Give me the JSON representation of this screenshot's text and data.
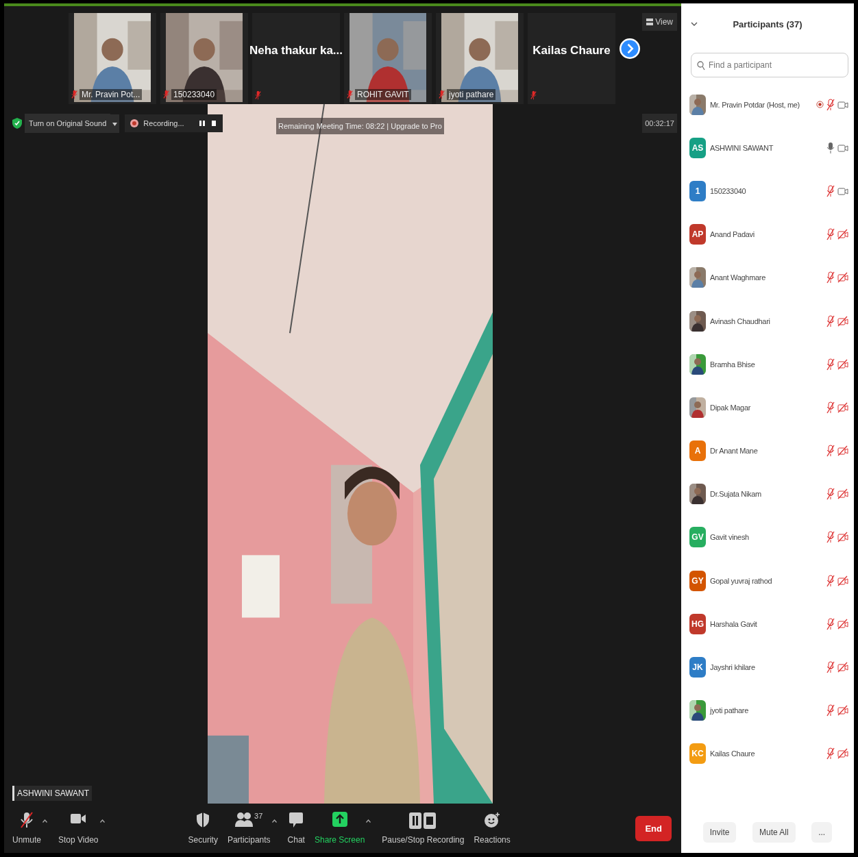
{
  "thumbnails": [
    {
      "name": "Mr. Pravin Pot...",
      "kind": "picture",
      "muted": true
    },
    {
      "name": "150233040",
      "kind": "picture",
      "muted": true
    },
    {
      "name": "Neha thakur ka...",
      "kind": "name",
      "muted": true
    },
    {
      "name": "ROHIT GAVIT",
      "kind": "picture",
      "muted": true
    },
    {
      "name": "jyoti pathare",
      "kind": "picture",
      "muted": true
    },
    {
      "name": "Kailas Chaure",
      "kind": "name",
      "muted": true
    }
  ],
  "view_button": "View",
  "original_sound_button": "Turn on Original Sound",
  "recording": {
    "label": "Recording..."
  },
  "meeting_banner": "Remaining Meeting Time: 08:22 | Upgrade to Pro",
  "timer": "00:32:17",
  "active_speaker": "ASHWINI SAWANT",
  "toolbar": [
    {
      "label": "Unmute",
      "caret": true
    },
    {
      "label": "Stop Video",
      "caret": true
    },
    {
      "label": "Security",
      "caret": false
    },
    {
      "label": "Participants",
      "caret": true,
      "count": "37"
    },
    {
      "label": "Chat",
      "caret": false
    },
    {
      "label": "Share Screen",
      "caret": true
    },
    {
      "label": "Pause/Stop Recording",
      "caret": false
    },
    {
      "label": "Reactions",
      "caret": false
    }
  ],
  "end_button": "End",
  "participants_panel": {
    "title": "Participants (37)",
    "search": {
      "placeholder": "Find a participant"
    },
    "participants": [
      {
        "name": "Mr. Pravin Potdar (Host, me)",
        "kind": "picture",
        "recording": true,
        "mic_muted": true,
        "video_on": true
      },
      {
        "name": "ASHWINI SAWANT",
        "kind": "initials",
        "initials": "AS",
        "color": "#16a085",
        "recording": false,
        "mic_muted": false,
        "video_on": true
      },
      {
        "name": "150233040",
        "kind": "initials",
        "initials": "1",
        "color": "#2e7dc6",
        "recording": false,
        "mic_muted": true,
        "video_on": true
      },
      {
        "name": "Anand Padavi",
        "kind": "initials",
        "initials": "AP",
        "color": "#c0392b",
        "recording": false,
        "mic_muted": true,
        "video_on": false
      },
      {
        "name": "Anant Waghmare",
        "kind": "picture",
        "recording": false,
        "mic_muted": true,
        "video_on": false
      },
      {
        "name": "Avinash Chaudhari",
        "kind": "picture",
        "recording": false,
        "mic_muted": true,
        "video_on": false
      },
      {
        "name": "Bramha Bhise",
        "kind": "picture",
        "recording": false,
        "mic_muted": true,
        "video_on": false
      },
      {
        "name": "Dipak Magar",
        "kind": "picture",
        "recording": false,
        "mic_muted": true,
        "video_on": false
      },
      {
        "name": "Dr Anant Mane",
        "kind": "initials",
        "initials": "A",
        "color": "#e8710a",
        "recording": false,
        "mic_muted": true,
        "video_on": false
      },
      {
        "name": "Dr.Sujata Nikam",
        "kind": "picture",
        "recording": false,
        "mic_muted": true,
        "video_on": false
      },
      {
        "name": "Gavit vinesh",
        "kind": "initials",
        "initials": "GV",
        "color": "#27ae60",
        "recording": false,
        "mic_muted": true,
        "video_on": false
      },
      {
        "name": "Gopal yuvraj rathod",
        "kind": "initials",
        "initials": "GY",
        "color": "#d35400",
        "recording": false,
        "mic_muted": true,
        "video_on": false
      },
      {
        "name": "Harshala Gavit",
        "kind": "initials",
        "initials": "HG",
        "color": "#c0392b",
        "recording": false,
        "mic_muted": true,
        "video_on": false
      },
      {
        "name": "Jayshri khilare",
        "kind": "initials",
        "initials": "JK",
        "color": "#2e7dc6",
        "recording": false,
        "mic_muted": true,
        "video_on": false
      },
      {
        "name": "jyoti pathare",
        "kind": "picture",
        "recording": false,
        "mic_muted": true,
        "video_on": false
      },
      {
        "name": "Kailas Chaure",
        "kind": "initials",
        "initials": "KC",
        "color": "#f39c12",
        "recording": false,
        "mic_muted": true,
        "video_on": false
      }
    ],
    "buttons": [
      "Invite",
      "Mute All",
      "..."
    ]
  }
}
